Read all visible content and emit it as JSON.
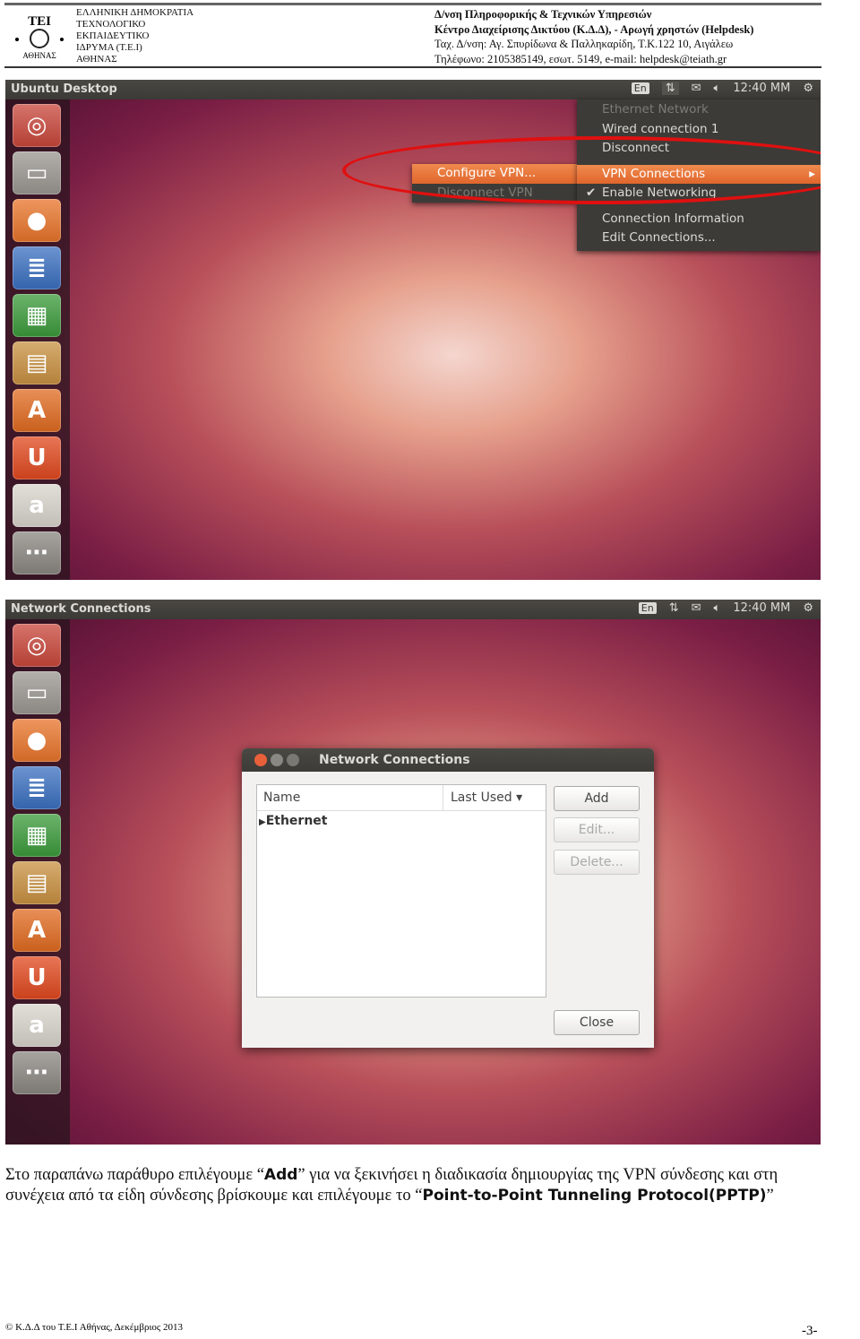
{
  "header": {
    "logo_text": "ΤΕΙ ΑΘΗΝΑΣ",
    "left_lines": [
      "ΕΛΛΗΝΙΚΗ ΔΗΜΟΚΡΑΤΙΑ",
      "ΤΕΧΝΟΛΟΓΙΚΟ",
      "ΕΚΠΑΙΔΕΥΤΙΚΟ",
      "ΙΔΡΥΜΑ (Τ.Ε.Ι)",
      "ΑΘΗΝΑΣ"
    ],
    "right_lines": [
      "Δ/νση Πληροφορικής & Τεχνικών Υπηρεσιών",
      "Κέντρο Διαχείρισης Δικτύου (Κ.Δ.Δ), - Αρωγή χρηστών (Helpdesk)",
      "Ταχ. Δ/νση: Αγ. Σπυρίδωνα & Παλληκαρίδη, Τ.Κ.122 10, Αιγάλεω",
      "Τηλέφωνο: 2105385149, εσωτ. 5149,  e-mail: helpdesk@teiath.gr"
    ]
  },
  "tray": {
    "lang": "En",
    "clock": "12:40 MM"
  },
  "launcher": [
    {
      "icon": "dash-icon",
      "g": "◎",
      "c": "#c8463a"
    },
    {
      "icon": "files-icon",
      "g": "▭",
      "c": "#9a9690"
    },
    {
      "icon": "firefox-icon",
      "g": "●",
      "c": "#e8742a"
    },
    {
      "icon": "writer-icon",
      "g": "≣",
      "c": "#3a6fc0"
    },
    {
      "icon": "calc-icon",
      "g": "▦",
      "c": "#3b9a3b"
    },
    {
      "icon": "impress-icon",
      "g": "▤",
      "c": "#c89040"
    },
    {
      "icon": "software-center-icon",
      "g": "A",
      "c": "#e06a20"
    },
    {
      "icon": "ubuntu-one-icon",
      "g": "U",
      "c": "#e0481e"
    },
    {
      "icon": "amazon-icon",
      "g": "a",
      "c": "#d8d4cc"
    },
    {
      "icon": "extras-icon",
      "g": "⋯",
      "c": "#8a8680"
    }
  ],
  "shot1": {
    "title": "Ubuntu Desktop",
    "menu": [
      {
        "label": "Ethernet Network",
        "state": "disabled"
      },
      {
        "label": "Wired connection 1",
        "state": "normal"
      },
      {
        "label": "Disconnect",
        "state": "normal"
      },
      {
        "label": "VPN Connections",
        "state": "selected",
        "submenu": true
      },
      {
        "label": "Enable Networking",
        "state": "checked"
      },
      {
        "label": "Connection Information",
        "state": "normal"
      },
      {
        "label": "Edit Connections...",
        "state": "normal"
      }
    ],
    "submenu": [
      {
        "label": "Configure VPN...",
        "state": "selected"
      },
      {
        "label": "Disconnect VPN",
        "state": "disabled"
      }
    ],
    "highlight_color": "#e01010"
  },
  "shot2": {
    "title": "Network Connections",
    "dialog": {
      "title": "Network Connections",
      "columns": [
        "Name",
        "Last Used ▾"
      ],
      "rows": [
        "Ethernet"
      ],
      "buttons": {
        "add": "Add",
        "edit": "Edit...",
        "delete": "Delete...",
        "close": "Close"
      }
    }
  },
  "body": {
    "t1": "Στο παραπάνω παράθυρο επιλέγουμε “",
    "b1": "Add",
    "t2": "” για να ξεκινήσει η διαδικασία δημιουργίας της VPN σύνδεσης και στη συνέχεια από τα είδη σύνδεσης  βρίσκουμε και επιλέγουμε  το “",
    "b2": "Point-to-Point Tunneling Protocol(PPTP)",
    "t3": "”"
  },
  "footer": {
    "copyright": "© Κ.Δ.Δ του Τ.Ε.Ι Αθήνας, Δεκέμβριος 2013",
    "page": "-3-"
  }
}
